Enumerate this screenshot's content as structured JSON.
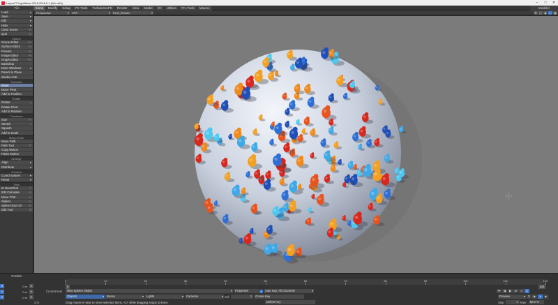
{
  "window": {
    "title": "Layout™ LightWave 2018 2018.0.1 (Win x64)",
    "controls": [
      "–",
      "□",
      "✕"
    ]
  },
  "menu": {
    "left_label": "File",
    "tabs": [
      "Items",
      "Modify",
      "Setup",
      "FX Tools",
      "TurbulenceFD",
      "Render",
      "View",
      "Model",
      "I/O",
      "Utilities",
      "Pro Tools",
      "Macros"
    ],
    "active_tab": 0,
    "modeler_label": "Modeler"
  },
  "sidebar": {
    "groups": [
      {
        "header": "",
        "items": [
          {
            "label": "Load",
            "dd": true
          },
          {
            "label": "Save",
            "dd": true
          },
          {
            "label": "Edit",
            "dd": true
          },
          {
            "label": "Help",
            "dd": true
          },
          {
            "label": "Clear Scene",
            "sc": "^N"
          },
          {
            "label": "Quit",
            "sc": "^Q"
          }
        ]
      },
      {
        "header": "Editors",
        "items": [
          {
            "label": "Scene Editor",
            "sc": "^F1"
          },
          {
            "label": "Surface Editor",
            "sc": "F5"
          },
          {
            "label": "Presets",
            "sc": "F8"
          },
          {
            "label": "Image Editor",
            "sc": "F6"
          },
          {
            "label": "Graph Editor",
            "sc": "^F2"
          },
          {
            "label": "Backdrop",
            "sc": ""
          },
          {
            "label": "More Windows",
            "dd": true
          },
          {
            "label": "Parent in Place",
            "sc": ""
          },
          {
            "label": "Studio LIVE",
            "sc": ""
          }
        ]
      },
      {
        "header": "Translate",
        "items": [
          {
            "label": "Move",
            "sc": "t",
            "active": true
          },
          {
            "label": "Move Pivot",
            "sc": ""
          },
          {
            "label": "Add to Position",
            "sc": ""
          }
        ]
      },
      {
        "header": "Rotate",
        "items": [
          {
            "label": "Rotate",
            "sc": "y"
          },
          {
            "label": "Rotate Pivot",
            "sc": ""
          },
          {
            "label": "Add to Rotation",
            "sc": ""
          }
        ]
      },
      {
        "header": "Transform",
        "items": [
          {
            "label": "Size",
            "sc": "^H"
          },
          {
            "label": "Stretch",
            "sc": "h"
          },
          {
            "label": "Squash",
            "sc": ""
          },
          {
            "label": "Add to Scale",
            "sc": ""
          }
        ]
      },
      {
        "header": "Motion Path",
        "items": [
          {
            "label": "Move Path",
            "sc": ""
          },
          {
            "label": "Path Tool",
            "sc": "^T"
          },
          {
            "label": "Copy Motion",
            "sc": ""
          },
          {
            "label": "Paste Motion",
            "sc": ""
          }
        ]
      },
      {
        "header": "Arrange",
        "items": [
          {
            "label": "Align",
            "dd": true
          },
          {
            "label": "Distribute",
            "dd": true
          }
        ]
      },
      {
        "header": "General",
        "items": [
          {
            "label": "Coord System",
            "dd": true
          },
          {
            "label": "Reset",
            "dd": true
          }
        ]
      },
      {
        "header": "Tools",
        "items": [
          {
            "label": "IK BoostTool",
            "sc": "^F"
          },
          {
            "label": "IKB Calculate",
            "sc": "^E"
          },
          {
            "label": "Move TCB",
            "sc": "^G"
          },
          {
            "label": "Sliders",
            "sc": "^Y"
          },
          {
            "label": "Spline Disp Ctrl",
            "sc": "^D"
          },
          {
            "label": "Edit Tool",
            "sc": "^B"
          }
        ]
      }
    ]
  },
  "viewport": {
    "view_mode": "Perspective",
    "render_mode": "VPR",
    "display_mode": "Final_Render",
    "icons": [
      "gear-icon",
      "maximize-icon",
      "eye-icon",
      "camera-icon",
      "layout-icon"
    ]
  },
  "timeline": {
    "position_label": "Position",
    "ticks": [
      0,
      10,
      20,
      30,
      40,
      50,
      60,
      70,
      80,
      90,
      100,
      110,
      120
    ],
    "current_frame": "0",
    "end_frame": "120",
    "axes": [
      {
        "axis": "X",
        "value": "0 m"
      },
      {
        "axis": "Y",
        "value": "0 m"
      },
      {
        "axis": "Z",
        "value": "0 m"
      }
    ],
    "grid_value": "2 m",
    "current_item_label": "Current Item",
    "current_item": "New Sphere Object",
    "objects_label": "Objects",
    "bones_label": "Bones",
    "lights_label": "Lights",
    "cameras_label": "Cameras",
    "properties_label": "Properties",
    "sel_label": "Sel:",
    "sel_value": "1",
    "auto_key_label": "Auto Key: All Channels",
    "create_key_label": "Create Key",
    "delete_key_label": "Delete Key",
    "preview_label": "Preview",
    "step_label": "Step",
    "step_value": "1",
    "rate_label": "Rate:",
    "rate_value": "50.0 %",
    "status": "Drag mouse in view to move selected items. ALT while dragging snaps to items."
  },
  "colors": {
    "accent": "#3e78c8",
    "viewport_bg": "#7b7b7b",
    "sphere": "#cfd6e2"
  }
}
